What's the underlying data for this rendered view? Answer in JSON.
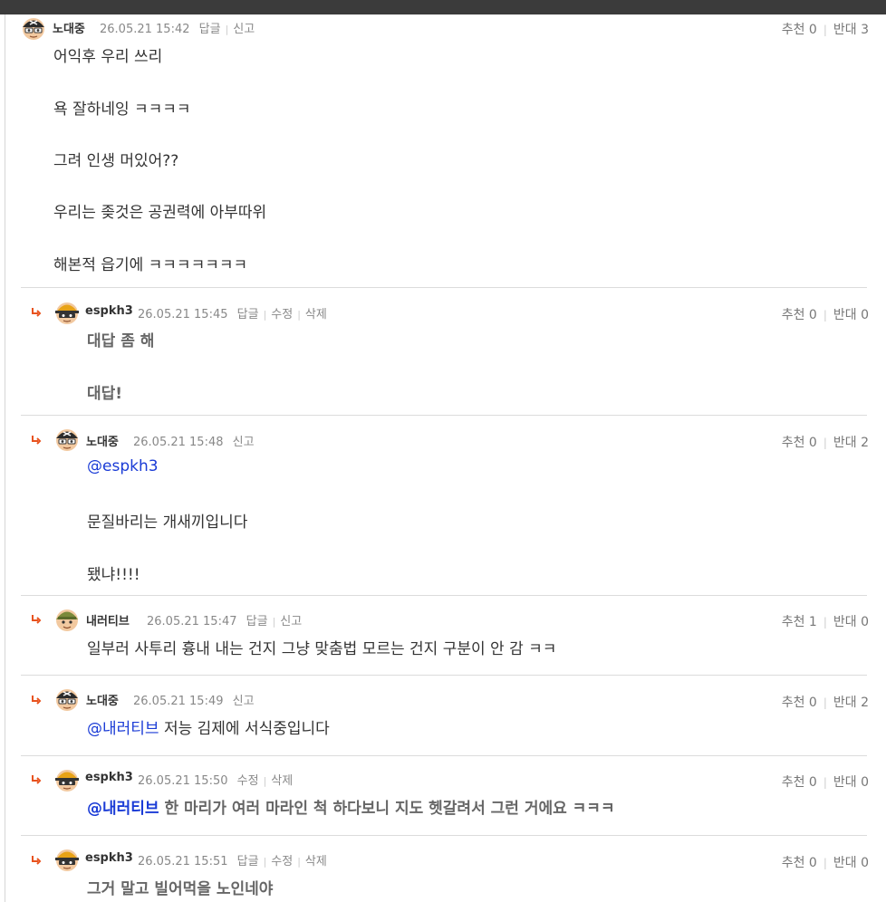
{
  "comments": [
    {
      "nick": "노대중",
      "date": "26.05.21 15:42",
      "actions": [
        "답글",
        "신고"
      ],
      "up_label": "추천 0",
      "down_label": "반대 3",
      "lines": [
        "어익후 우리 쓰리",
        "욕 잘하네잉 ㅋㅋㅋㅋ",
        "그려 인생 머있어??",
        "우리는 좆것은 공권력에 아부따위",
        "해본적 읍기에 ㅋㅋㅋㅋㅋㅋㅋ"
      ]
    },
    {
      "nick": "espkh3",
      "date": "26.05.21 15:45",
      "actions": [
        "답글",
        "수정",
        "삭제"
      ],
      "up_label": "추천 0",
      "down_label": "반대 0",
      "lines": [
        "대답 좀 해",
        "대답!"
      ]
    },
    {
      "nick": "노대중",
      "date": "26.05.21 15:48",
      "actions": [
        "신고"
      ],
      "up_label": "추천 0",
      "down_label": "반대 2",
      "mention": "@espkh3",
      "lines": [
        "문질바리는 개새끼입니다",
        "됐냐!!!!"
      ]
    },
    {
      "nick": "내러티브",
      "date": "26.05.21 15:47",
      "actions": [
        "답글",
        "신고"
      ],
      "up_label": "추천 1",
      "down_label": "반대 0",
      "lines": [
        "일부러 사투리 흉내 내는 건지 그냥 맞춤법 모르는 건지 구분이 안 감 ㅋㅋ"
      ]
    },
    {
      "nick": "노대중",
      "date": "26.05.21 15:49",
      "actions": [
        "신고"
      ],
      "up_label": "추천 0",
      "down_label": "반대 2",
      "mention": "@내러티브",
      "mention_rest": " 저능 김제에 서식중입니다"
    },
    {
      "nick": "espkh3",
      "date": "26.05.21 15:50",
      "actions": [
        "수정",
        "삭제"
      ],
      "up_label": "추천 0",
      "down_label": "반대 0",
      "mention": "@내러티브",
      "mention_rest": " 한 마리가 여러 마라인 척 하다보니 지도 헷갈려서 그런 거에요 ㅋㅋㅋ"
    },
    {
      "nick": "espkh3",
      "date": "26.05.21 15:51",
      "actions": [
        "답글",
        "수정",
        "삭제"
      ],
      "up_label": "추천 0",
      "down_label": "반대 0",
      "lines": [
        "그거 말고 빌어먹을 노인네야"
      ]
    }
  ],
  "colors": {
    "mention": "#1a3bd6",
    "reply_arrow": "#e8531f"
  }
}
